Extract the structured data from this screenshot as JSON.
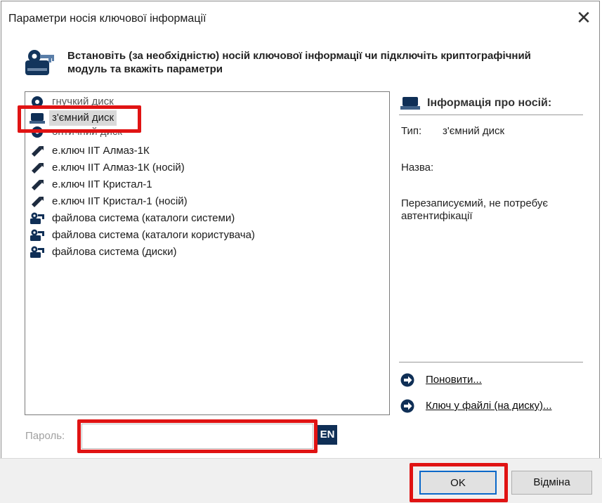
{
  "window": {
    "title": "Параметри носія ключової інформації"
  },
  "header": {
    "text": "Встановіть (за необхідністю) носій ключової інформації чи підключіть криптографічний модуль та вкажіть параметри"
  },
  "media_list": {
    "items": [
      {
        "label": "гнучкий диск",
        "icon": "floppy-disk-icon"
      },
      {
        "label": "з'ємний диск",
        "icon": "removable-disk-icon",
        "selected": true
      },
      {
        "label": "оптичний диск",
        "icon": "optical-disk-icon"
      },
      {
        "label": "е.ключ ІІТ Алмаз-1К",
        "icon": "usb-key-icon"
      },
      {
        "label": "е.ключ ІІТ Алмаз-1К (носій)",
        "icon": "usb-key-icon"
      },
      {
        "label": "е.ключ ІІТ Кристал-1",
        "icon": "usb-key-icon"
      },
      {
        "label": "е.ключ ІІТ Кристал-1 (носій)",
        "icon": "usb-key-icon"
      },
      {
        "label": "файлова система (каталоги системи)",
        "icon": "file-system-icon"
      },
      {
        "label": "файлова система (каталоги користувача)",
        "icon": "file-system-icon"
      },
      {
        "label": "файлова система (диски)",
        "icon": "file-system-icon"
      }
    ]
  },
  "info": {
    "header": "Інформація про носій:",
    "type_label": "Тип:",
    "type_value": "з'ємний диск",
    "name_label": "Назва:",
    "description": "Перезаписуємий, не потребує автентифікації",
    "refresh_link": "Поновити...",
    "key_file_link": "Ключ у файлі (на диску)..."
  },
  "password": {
    "label": "Пароль:",
    "value": "",
    "placeholder": ""
  },
  "lang_indicator": "EN",
  "buttons": {
    "ok": "OK",
    "cancel": "Відміна"
  },
  "colors": {
    "highlight": "#e01313",
    "lang_badge_bg": "#0f2f56",
    "ok_border": "#0a68c9"
  }
}
